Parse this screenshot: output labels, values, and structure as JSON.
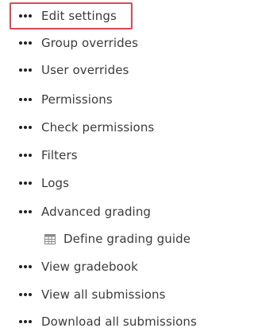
{
  "menu": {
    "items": [
      {
        "label": "Edit settings",
        "icon": "ellipsis-icon"
      },
      {
        "label": "Group overrides",
        "icon": "ellipsis-icon"
      },
      {
        "label": "User overrides",
        "icon": "ellipsis-icon"
      },
      {
        "label": "Permissions",
        "icon": "ellipsis-icon"
      },
      {
        "label": "Check permissions",
        "icon": "ellipsis-icon"
      },
      {
        "label": "Filters",
        "icon": "ellipsis-icon"
      },
      {
        "label": "Logs",
        "icon": "ellipsis-icon"
      },
      {
        "label": "Advanced grading",
        "icon": "ellipsis-icon"
      },
      {
        "label": "Define grading guide",
        "icon": "grid-icon"
      },
      {
        "label": "View gradebook",
        "icon": "ellipsis-icon"
      },
      {
        "label": "View all submissions",
        "icon": "ellipsis-icon"
      },
      {
        "label": "Download all submissions",
        "icon": "ellipsis-icon"
      }
    ]
  },
  "colors": {
    "highlight_border": "#e0464f",
    "text": "#3b3b3b",
    "icon_grid": "#8a8a8a"
  }
}
